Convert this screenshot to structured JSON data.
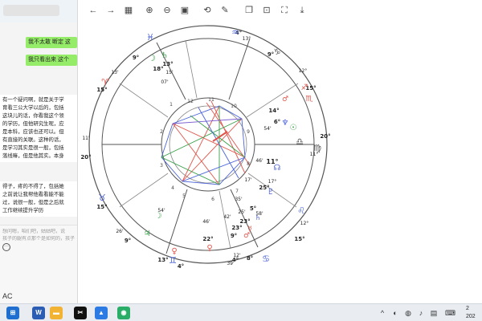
{
  "chat": {
    "bubble1": "我不太敢 断定 这",
    "bubble2": "我只看出来 这个",
    "message": [
      "有一个疑问啊，就是关于学",
      "育看三公大学以后的，包括",
      "这块儿的话，你看我这个领",
      "的学历，但他研究生呢，应",
      "是本科，应该也还可以。但",
      "有直接的关联。这种的话，",
      "是学习其实是很一般，包括",
      "落线嘛，但是他其实。本身"
    ],
    "message2": [
      "得子，疼的不得了，包括她",
      "之前说让我帮他看看能不能",
      "过，说很一般，但是之后就",
      "工作继续提升学历"
    ],
    "input_lines": [
      "想问嗯，咱们吧，姑姑吧，说",
      "孩子的腿有点那个是如何的，孩子未来"
    ],
    "more_icon": "···",
    "bottom_label": "AC"
  },
  "toolbar_icons": [
    "back-arrow-icon",
    "forward-arrow-icon",
    "grid-icon",
    "zoom-in-icon",
    "zoom-out-icon",
    "fit-icon",
    "rotate-icon",
    "edit-icon",
    "copy-icon",
    "crop-icon",
    "scan-icon",
    "download-icon"
  ],
  "toolbar_glyphs": [
    "←",
    "→",
    "▦",
    "⊕",
    "⊖",
    "▣",
    "⟲",
    "✎",
    "❐",
    "⊡",
    "⛶",
    "⤓"
  ],
  "chart_data": {
    "type": "astrology-natal-wheel",
    "house_numbers": [
      "1",
      "2",
      "3",
      "4",
      "5",
      "6",
      "7",
      "8",
      "9",
      "10",
      "11",
      "12"
    ],
    "labels": {
      "top_4": "4°",
      "top_13": "13°",
      "top_9": "9°",
      "upper_right_12": "12°",
      "right_15": "15°",
      "right_20": "20°",
      "right_11": "11°",
      "right_17": "17°",
      "lower_right_15": "15°",
      "lower_right_12": "12°",
      "bottom_8": "8°",
      "bottom_39": "39'",
      "bottom_4": "4°",
      "bottom_13": "13°",
      "lower_left_26": "26'",
      "lower_left_9": "9°",
      "left_15": "15°",
      "left_20": "20°",
      "left_11": "11'",
      "upper_left_15": "15°",
      "upper_left_13": "13'",
      "upper_left_9": "9°",
      "moon_13": "13°",
      "moon_18": "18°",
      "moon_15": "15'",
      "moon_07": "07'",
      "p_14": "14°",
      "p_6": "6°",
      "p_54": "54'",
      "p_46": "46'",
      "p_11": "11°",
      "p_25": "25°",
      "p_17": "17'",
      "p_35": "35'",
      "p_5": "5°",
      "p_58": "58'",
      "p_25b": "25'",
      "p_23": "23°",
      "p_23b": "23°",
      "p_42": "42'",
      "p_46b": "46'",
      "p_22": "22°",
      "p_9": "9°",
      "p_54b": "54'",
      "p_12": "12'",
      "p_4": "4°"
    },
    "glyphs": {
      "aries": "♈",
      "taurus": "♉",
      "gemini": "♊",
      "cancer": "♋",
      "leo": "♌",
      "virgo": "♍",
      "libra": "♎",
      "scorpio": "♏",
      "sagittarius": "♐",
      "capricorn": "♑",
      "aquarius": "♒",
      "pisces": "♓",
      "moon": "☽",
      "neptune": "♆",
      "venus": "♀",
      "mars": "♂",
      "saturn": "♄",
      "jupiter": "♃",
      "sun": "☉",
      "north_node": "☊",
      "pluto": "♇",
      "mercury": "☿"
    },
    "colors": {
      "wheel": "#555555",
      "red": "#e0554a",
      "blue": "#4a63d8",
      "green": "#3aa14a",
      "purple": "#7b5bd0"
    }
  },
  "taskbar": {
    "icons": [
      "windows-icon",
      "search-icon",
      "task-view-icon",
      "word-icon",
      "explorer-icon",
      "capcut-icon",
      "app-icon",
      "wechat-icon"
    ],
    "glyphs": [
      "⊞",
      "○",
      "▭",
      "W",
      "▬",
      "✂",
      "▲",
      "◉"
    ],
    "colors": [
      "#1f6fd1",
      "#444444",
      "#444444",
      "#2b5db5",
      "#f2b233",
      "#111111",
      "#2c7be5",
      "#2aae67"
    ],
    "tray": [
      "^",
      "◐",
      "◍",
      "♪",
      "▤",
      "⌨"
    ],
    "clock": [
      "2",
      "202"
    ]
  }
}
